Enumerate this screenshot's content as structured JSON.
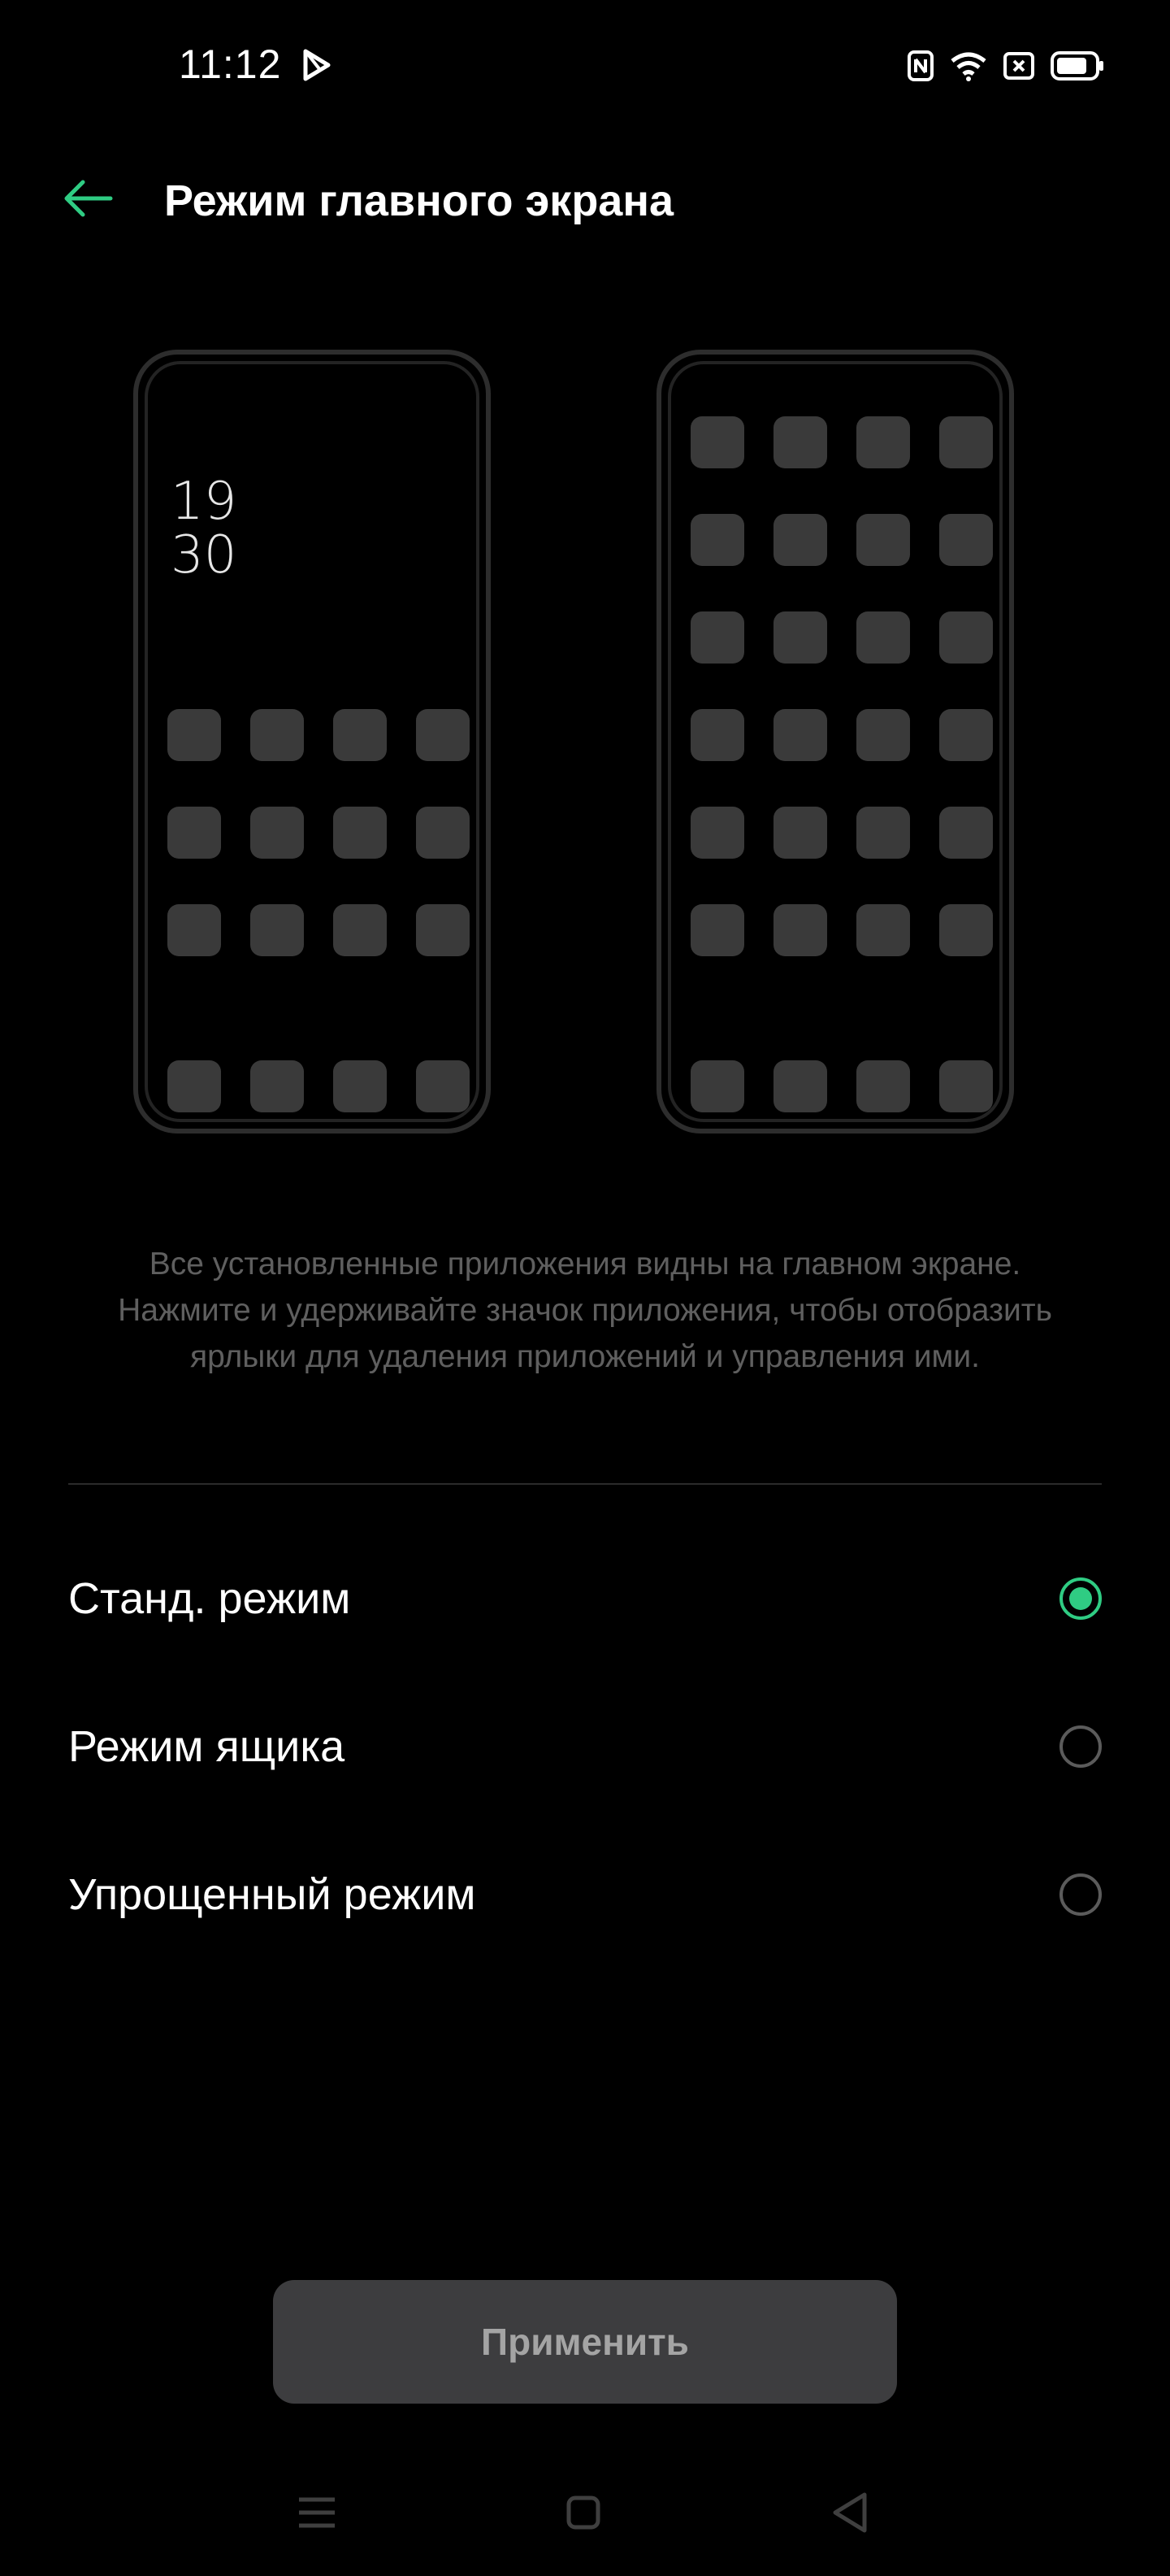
{
  "status_bar": {
    "time": "11:12",
    "icons": [
      "play-store-notification-icon",
      "nfc-icon",
      "wifi-icon",
      "sim-x-icon",
      "battery-icon"
    ]
  },
  "header": {
    "title": "Режим главного экрана",
    "back_icon": "arrow-left-icon",
    "accent_color": "#2fcc83"
  },
  "preview": {
    "clock_hour": "19",
    "clock_minute": "30"
  },
  "description": {
    "line1": "Все установленные приложения видны на главном экране.",
    "line2": "Нажмите и удерживайте значок приложения, чтобы отобразить",
    "line3": "ярлыки для удаления приложений и управления ими."
  },
  "options": [
    {
      "label": "Станд. режим",
      "selected": true
    },
    {
      "label": "Режим ящика",
      "selected": false
    },
    {
      "label": "Упрощенный режим",
      "selected": false
    }
  ],
  "apply_button": {
    "label": "Применить"
  },
  "nav_bar": {
    "icons": [
      "menu-icon",
      "home-icon",
      "back-triangle-icon"
    ]
  }
}
